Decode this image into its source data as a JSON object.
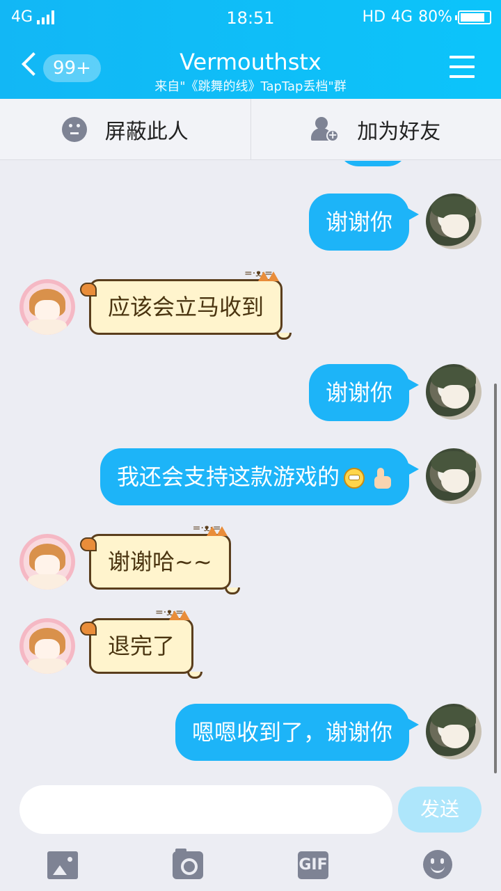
{
  "status": {
    "network_left": "4G",
    "time": "18:51",
    "hd": "HD",
    "network_right": "4G",
    "battery": "80%"
  },
  "header": {
    "badge": "99+",
    "title": "Vermouthstx",
    "subtitle": "来自\"《跳舞的线》TapTap丢档\"群"
  },
  "actions": {
    "block": "屏蔽此人",
    "add_friend": "加为好友"
  },
  "messages": [
    {
      "side": "out",
      "text": "谢谢你"
    },
    {
      "side": "in",
      "text": "应该会立马收到"
    },
    {
      "side": "out",
      "text": "谢谢你"
    },
    {
      "side": "out",
      "text": "我还会支持这款游戏的"
    },
    {
      "side": "in",
      "text": "谢谢哈~~"
    },
    {
      "side": "in",
      "text": "退完了"
    },
    {
      "side": "out",
      "text": "嗯嗯收到了，谢谢你"
    }
  ],
  "input": {
    "placeholder": "",
    "send_label": "发送"
  },
  "tools": {
    "gif_label": "GIF"
  },
  "colors": {
    "header": "#12B7F5",
    "bubble_out": "#1DB4F8",
    "bubble_in": "#FFF4CD",
    "background": "#ECEDF3"
  }
}
